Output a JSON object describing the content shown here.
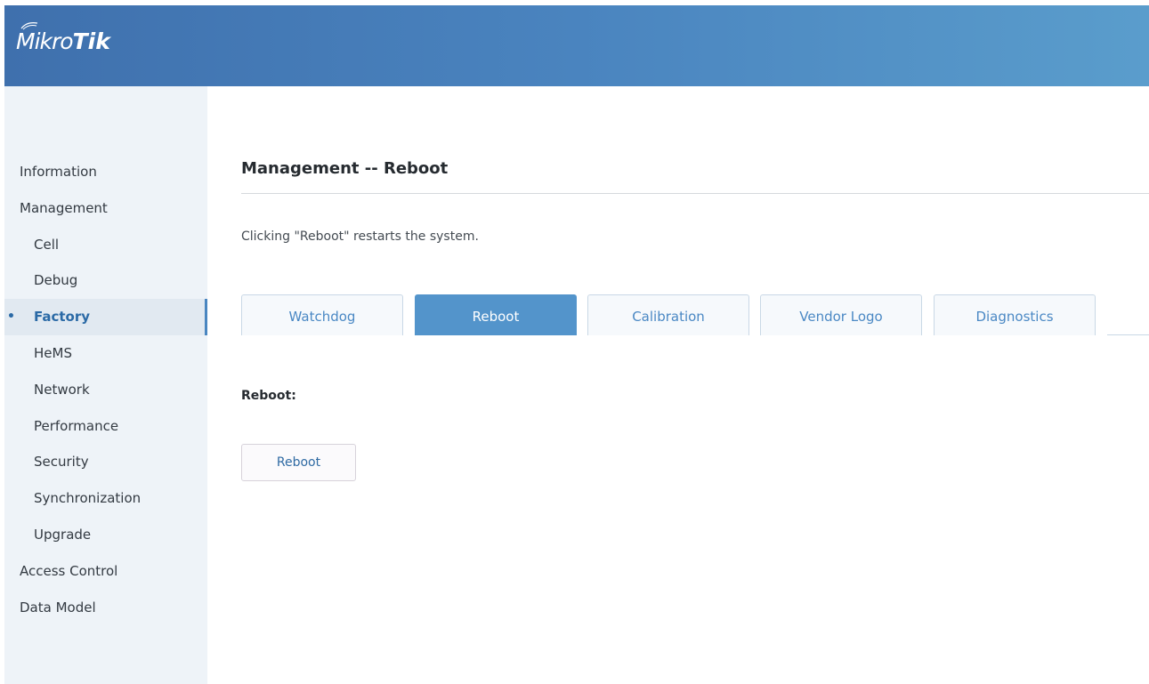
{
  "header": {
    "logo_light": "Mikro",
    "logo_bold": "Tik",
    "gradient_start": "#3f70ad",
    "gradient_end": "#5a9dcc"
  },
  "sidebar": {
    "items": [
      {
        "label": "Information",
        "level": 1
      },
      {
        "label": "Management",
        "level": 1
      },
      {
        "label": "Cell",
        "level": 2
      },
      {
        "label": "Debug",
        "level": 2
      },
      {
        "label": "Factory",
        "level": 2,
        "active": true,
        "bullet": "•"
      },
      {
        "label": "HeMS",
        "level": 2
      },
      {
        "label": "Network",
        "level": 2
      },
      {
        "label": "Performance",
        "level": 2
      },
      {
        "label": "Security",
        "level": 2
      },
      {
        "label": "Synchronization",
        "level": 2
      },
      {
        "label": "Upgrade",
        "level": 2
      },
      {
        "label": "Access Control",
        "level": 1
      },
      {
        "label": "Data Model",
        "level": 1
      }
    ]
  },
  "main": {
    "title": "Management -- Reboot",
    "description": "Clicking \"Reboot\" restarts the system.",
    "tabs": [
      {
        "label": "Watchdog"
      },
      {
        "label": "Reboot",
        "active": true
      },
      {
        "label": "Calibration"
      },
      {
        "label": "Vendor Logo"
      },
      {
        "label": "Diagnostics"
      }
    ],
    "section_label": "Reboot:",
    "reboot_button_label": "Reboot"
  },
  "colors": {
    "accent": "#5394cb",
    "sidebar_bg": "#eef3f8",
    "active_text": "#2b6aa6"
  }
}
